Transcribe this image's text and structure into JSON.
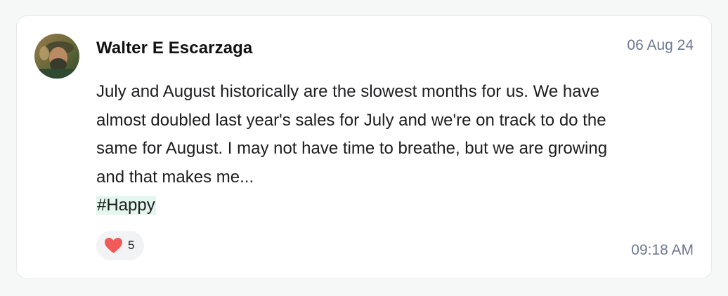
{
  "post": {
    "author": "Walter E Escarzaga",
    "date": "06 Aug 24",
    "message": "July and August historically are the slowest months for us. We have almost doubled last year's sales for July and we're on track to do the same for August. I may not have time to breathe, but we are growing and that makes me...",
    "hashtag": "#Happy",
    "time": "09:18 AM"
  },
  "reaction": {
    "icon": "heart-icon",
    "count": "5",
    "color": "#f25a5a"
  },
  "colors": {
    "meta": "#6f7891",
    "hashtag_bg": "#e3f7ee"
  }
}
